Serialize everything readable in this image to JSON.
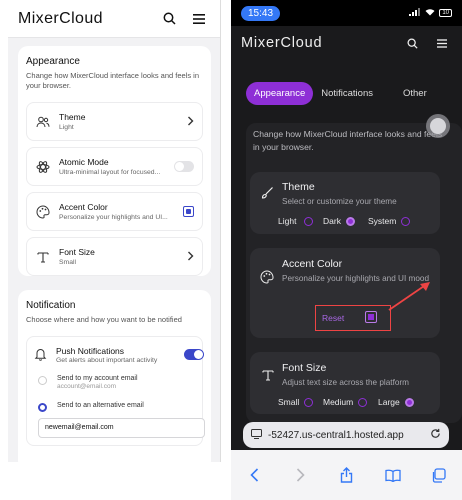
{
  "left": {
    "logo": "MixerCloud",
    "appearance": {
      "title": "Appearance",
      "desc": "Change how MixerCloud interface looks and feels in your browser.",
      "rows": [
        {
          "title": "Theme",
          "sub": "Light",
          "icon": "people-icon"
        },
        {
          "title": "Atomic Mode",
          "sub": "Ultra-minimal layout for focused...",
          "icon": "atom-icon"
        },
        {
          "title": "Accent Color",
          "sub": "Personalize your highlights and UI...",
          "icon": "palette-icon"
        },
        {
          "title": "Font Size",
          "sub": "Small",
          "icon": "text-icon"
        }
      ]
    },
    "notification": {
      "title": "Notification",
      "desc": "Choose where and how you want to be notified",
      "push_title": "Push Notifications",
      "push_sub": "Get alerts about important activity",
      "opt1": "Send to my account email",
      "opt1_sub": "account@email.com",
      "opt2": "Send to an alternative email",
      "email_value": "newemail@email.com"
    }
  },
  "right": {
    "time": "15:43",
    "battery": "10",
    "logo": "MixerCloud",
    "tabs": [
      "Appearance",
      "Notifications",
      "Other"
    ],
    "desc": "Change how MixerCloud interface looks and feels in your browser.",
    "theme": {
      "title": "Theme",
      "sub": "Select or customize your theme",
      "options": [
        "Light",
        "Dark",
        "System"
      ]
    },
    "accent": {
      "title": "Accent Color",
      "sub": "Personalize your highlights and UI mood",
      "reset": "Reset"
    },
    "font": {
      "title": "Font Size",
      "sub": "Adjust text size across the platform",
      "options": [
        "Small",
        "Medium",
        "Large"
      ]
    },
    "url": "-52427.us-central1.hosted.app"
  },
  "colors": {
    "accent_light": "#3b47c9",
    "accent_dark": "#8e2fd6",
    "annotation": "#e44444"
  }
}
